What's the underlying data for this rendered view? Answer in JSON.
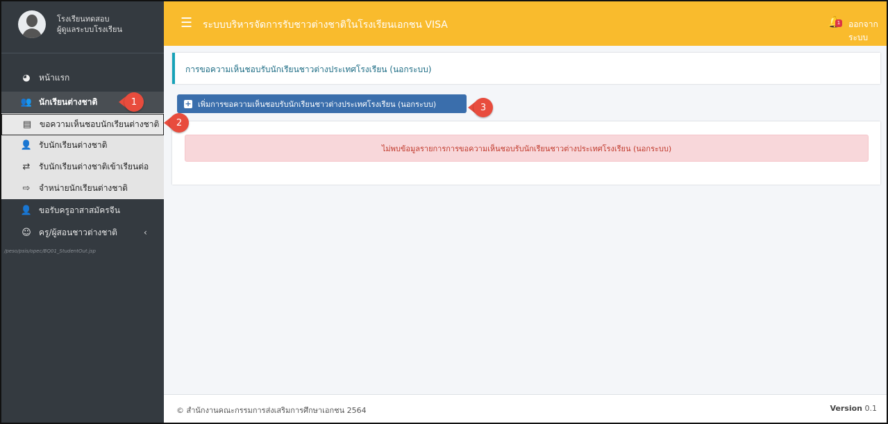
{
  "user": {
    "school": "โรงเรียนทดสอบ",
    "role": "ผู้ดูแลระบบโรงเรียน"
  },
  "sidebar": {
    "items": [
      {
        "label": "หน้าแรก",
        "icon": "dashboard-icon"
      },
      {
        "label": "นักเรียนต่างชาติ",
        "icon": "users-icon"
      },
      {
        "label": "ขอรับครูอาสาสมัครจีน",
        "icon": "user-plus-icon"
      },
      {
        "label": "ครู/ผู้สอนชาวต่างชาติ",
        "icon": "teacher-group-icon"
      }
    ],
    "submenu": [
      {
        "label": "ขอความเห็นชอบนักเรียนต่างชาติ",
        "icon": "document-icon"
      },
      {
        "label": "รับนักเรียนต่างชาติ",
        "icon": "user-check-icon"
      },
      {
        "label": "รับนักเรียนต่างชาติเข้าเรียนต่อ",
        "icon": "transfer-users-icon"
      },
      {
        "label": "จำหน่ายนักเรียนต่างชาติ",
        "icon": "sign-out-icon"
      }
    ],
    "path_hint": "/peso/psis/opec/BQ01_StudentOut.jsp"
  },
  "callouts": [
    "1",
    "2",
    "3"
  ],
  "header": {
    "title": "ระบบบริหารจัดการรับชาวต่างชาติในโรงเรียนเอกชน VISA",
    "notification_count": "1",
    "logout": "ออกจากระบบ"
  },
  "main": {
    "page_heading": "การขอความเห็นชอบรับนักเรียนชาวต่างประเทศโรงเรียน (นอกระบบ)",
    "add_button": "เพิ่มการขอความเห็นชอบรับนักเรียนชาวต่างประเทศโรงเรียน (นอกระบบ)",
    "empty_message": "ไม่พบข้อมูลรายการการขอความเห็นชอบรับนักเรียนชาวต่างประเทศโรงเรียน (นอกระบบ)"
  },
  "footer": {
    "copyright": "© สำนักงานคณะกรรมการส่งเสริมการศึกษาเอกชน 2564",
    "version_label": "Version",
    "version_number": "0.1"
  },
  "colors": {
    "topbar": "#f9bb2d",
    "sidebar": "#343a40",
    "primary_button": "#3a6eac",
    "callout": "#e84c3d",
    "alert_bg": "#f8d7da",
    "alert_text": "#c0392b"
  }
}
